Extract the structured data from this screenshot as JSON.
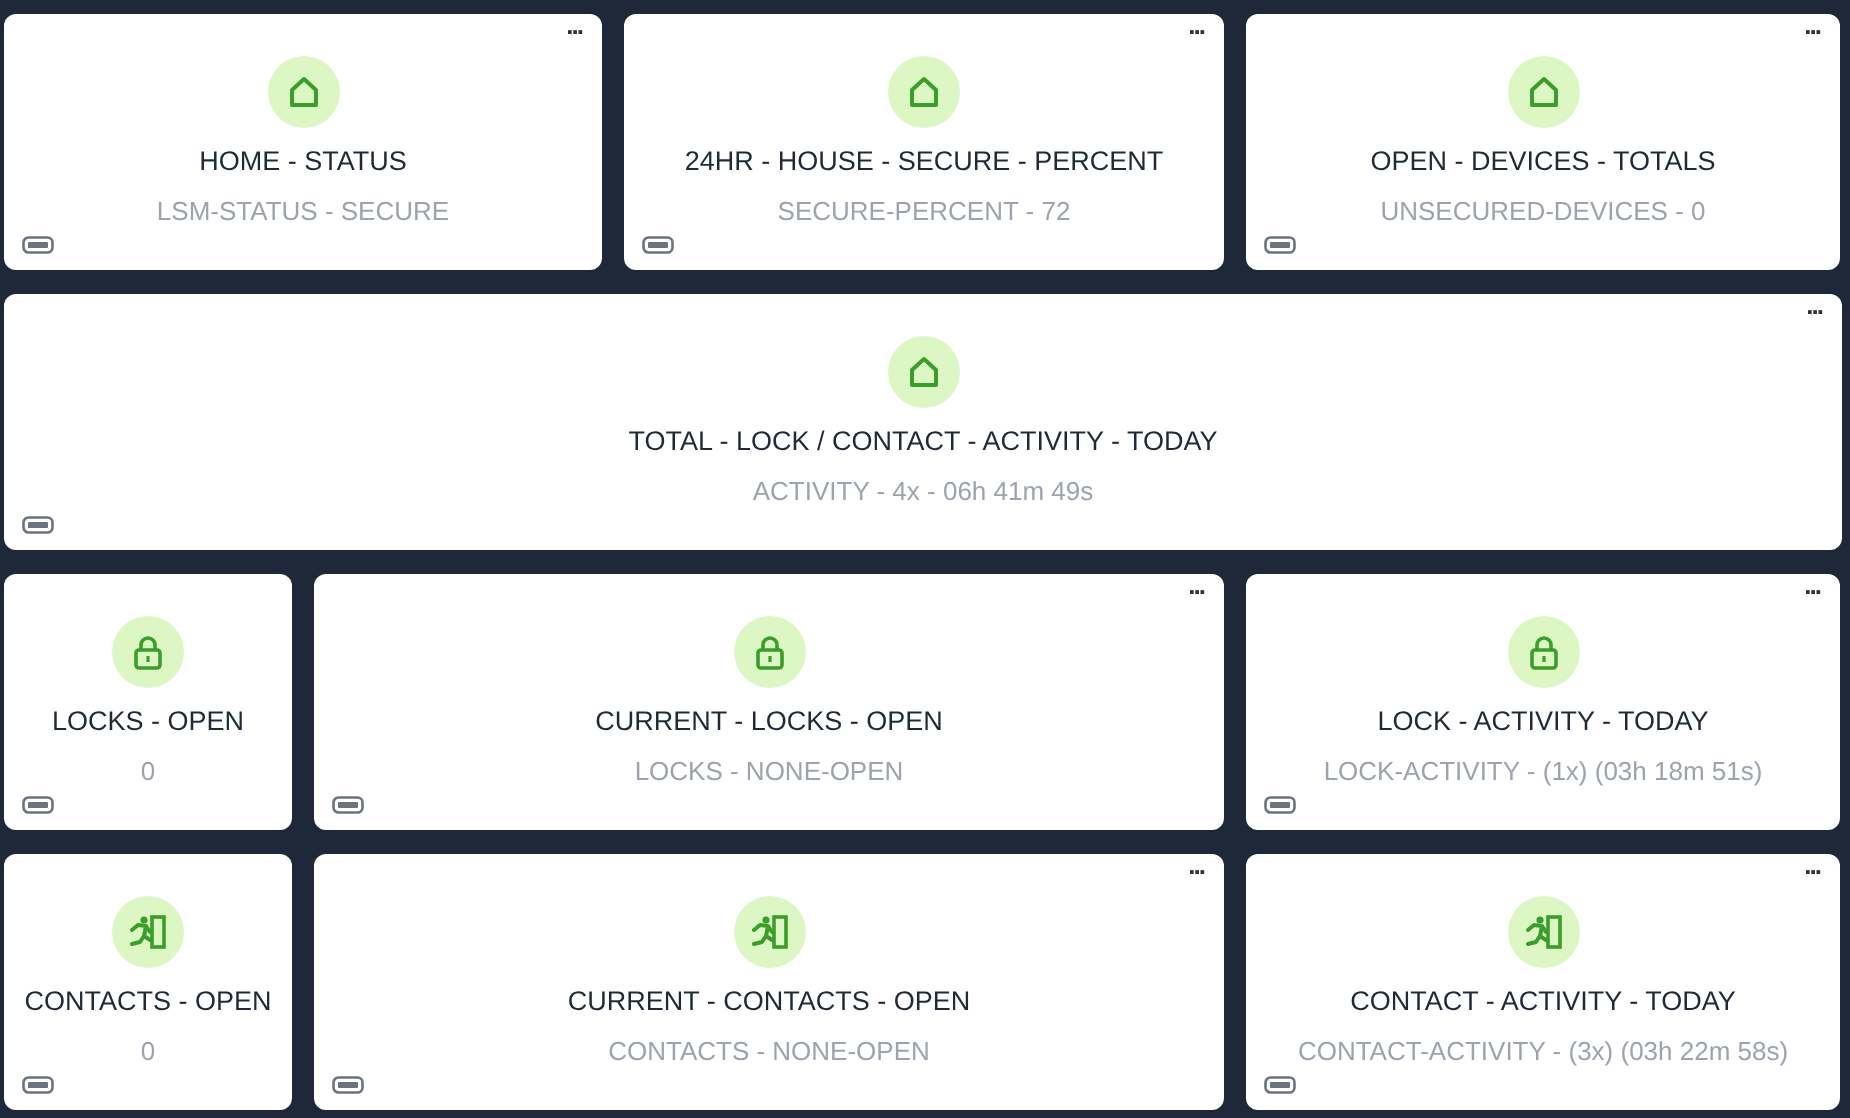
{
  "rows": [
    [
      {
        "kind": "home",
        "title": "HOME - STATUS",
        "value": "LSM-STATUS - SECURE",
        "menu": "..."
      },
      {
        "kind": "home",
        "title": "24HR - HOUSE - SECURE - PERCENT",
        "value": "SECURE-PERCENT - 72",
        "menu": "..."
      },
      {
        "kind": "home",
        "title": "OPEN - DEVICES - TOTALS",
        "value": "UNSECURED-DEVICES - 0",
        "menu": "..."
      }
    ],
    [
      {
        "kind": "home",
        "title": "TOTAL - LOCK / CONTACT - ACTIVITY - TODAY",
        "value": "ACTIVITY - 4x - 06h 41m 49s",
        "menu": "..."
      }
    ],
    [
      {
        "kind": "lock",
        "title": "LOCKS - OPEN",
        "value": "0"
      },
      {
        "kind": "lock",
        "title": "CURRENT - LOCKS - OPEN",
        "value": "LOCKS - NONE-OPEN",
        "menu": "..."
      },
      {
        "kind": "lock",
        "title": "LOCK - ACTIVITY - TODAY",
        "value": "LOCK-ACTIVITY - (1x) (03h 18m 51s)",
        "menu": "..."
      }
    ],
    [
      {
        "kind": "door",
        "title": "CONTACTS - OPEN",
        "value": "0"
      },
      {
        "kind": "door",
        "title": "CURRENT - CONTACTS - OPEN",
        "value": "CONTACTS - NONE-OPEN",
        "menu": "..."
      },
      {
        "kind": "door",
        "title": "CONTACT - ACTIVITY - TODAY",
        "value": "CONTACT-ACTIVITY - (3x) (03h 22m 58s)",
        "menu": "..."
      }
    ]
  ]
}
